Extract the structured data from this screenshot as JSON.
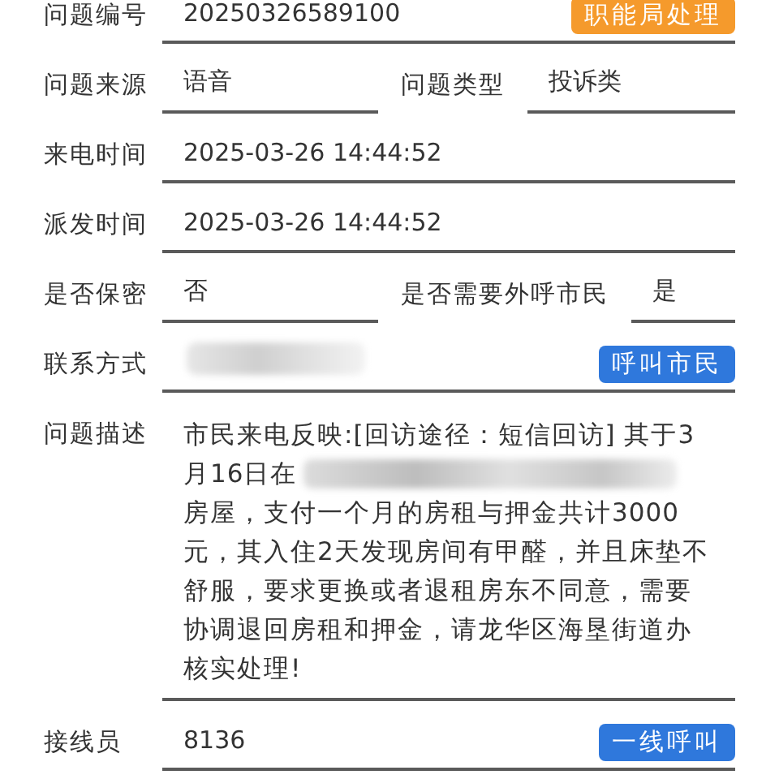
{
  "fields": [
    {
      "kind": "single",
      "label": "问题编号",
      "value": "20250326589100",
      "button": {
        "label": "职能局处理",
        "color": "#f59a2c"
      }
    },
    {
      "kind": "pair",
      "label": "问题来源",
      "value": "语音",
      "label2": "问题类型",
      "value2": "投诉类"
    },
    {
      "kind": "single",
      "label": "来电时间",
      "value": "2025-03-26 14:44:52"
    },
    {
      "kind": "single",
      "label": "派发时间",
      "value": "2025-03-26 14:44:52"
    },
    {
      "kind": "pair",
      "label": "是否保密",
      "value": "否",
      "label2": "是否需要外呼市民",
      "value2": "是"
    },
    {
      "kind": "redacted",
      "label": "联系方式",
      "button": {
        "label": "呼叫市民",
        "color": "#2f78dc"
      }
    },
    {
      "kind": "multiline",
      "label": "问题描述",
      "lines": [
        {
          "text": "市民来电反映:[回访途径：短信回访] 其于3",
          "redacted": false
        },
        {
          "text": "月16日在",
          "redacted": true
        },
        {
          "text": "房屋，支付一个月的房租与押金共计3000",
          "redacted": false
        },
        {
          "text": "元，其入住2天发现房间有甲醛，并且床垫不",
          "redacted": false
        },
        {
          "text": "舒服，要求更换或者退租房东不同意，需要",
          "redacted": false
        },
        {
          "text": "协调退回房租和押金，请龙华区海垦街道办",
          "redacted": false
        },
        {
          "text": "核实处理!",
          "redacted": false
        }
      ]
    },
    {
      "kind": "single",
      "label": "接线员",
      "value": "8136",
      "button": {
        "label": "一线呼叫",
        "color": "#2f78dc"
      }
    }
  ]
}
